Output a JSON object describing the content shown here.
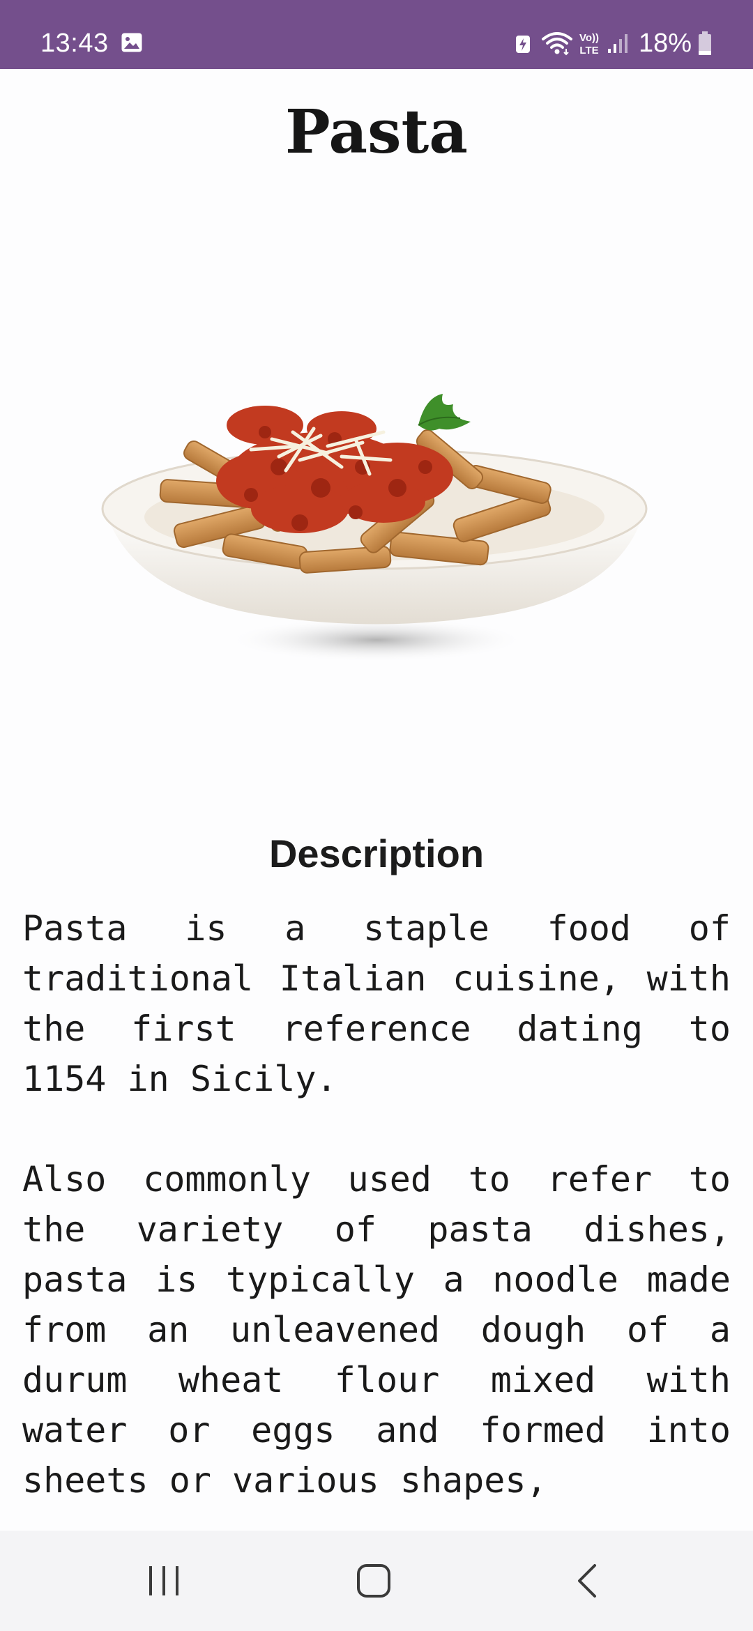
{
  "status_bar": {
    "time": "13:43",
    "battery": "18%",
    "background_color": "#744f8c"
  },
  "page": {
    "title": "Pasta",
    "image_icon": "pasta-dish-image"
  },
  "description": {
    "heading": "Description",
    "paragraphs": [
      "Pasta is a staple food of traditional Italian cuisine, with the first reference dating to 1154 in Sicily.",
      "Also commonly used to refer to the variety of pasta dishes, pasta is typically a noodle made from an unleavened dough of a durum wheat flour mixed with water or eggs and formed into sheets or various shapes,"
    ]
  },
  "nav_bar": {
    "recents_icon": "recents-icon",
    "home_icon": "home-icon",
    "back_icon": "back-icon"
  }
}
